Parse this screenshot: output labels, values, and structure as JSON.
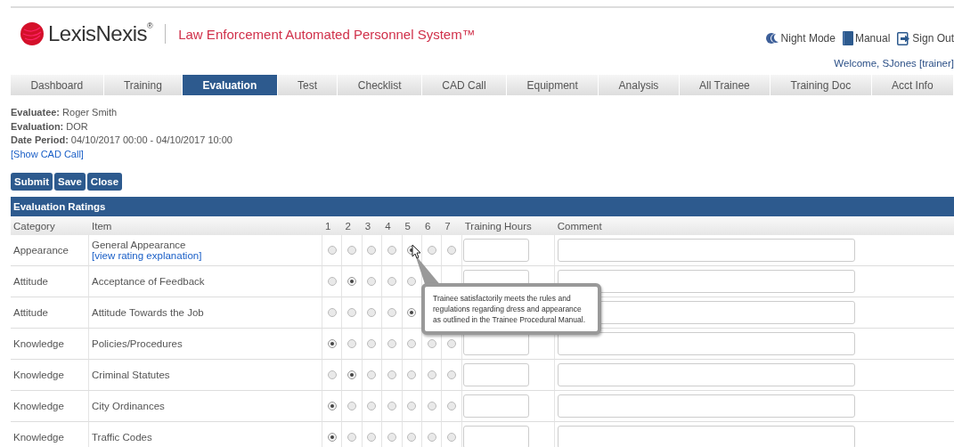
{
  "header": {
    "brand": "LexisNexis",
    "brand_mark": "®",
    "system_title": "Law Enforcement Automated Personnel System™",
    "links": [
      {
        "kind": "night",
        "label": "Night Mode"
      },
      {
        "kind": "manual",
        "label": "Manual"
      },
      {
        "kind": "signout",
        "label": "Sign Out"
      }
    ],
    "welcome": "Welcome, SJones [trainer]"
  },
  "tabs": [
    {
      "label": "Dashboard",
      "selected": false
    },
    {
      "label": "Training",
      "selected": false
    },
    {
      "label": "Evaluation",
      "selected": true
    },
    {
      "label": "Test",
      "selected": false
    },
    {
      "label": "Checklist",
      "selected": false
    },
    {
      "label": "CAD Call",
      "selected": false
    },
    {
      "label": "Equipment",
      "selected": false
    },
    {
      "label": "Analysis",
      "selected": false
    },
    {
      "label": "All Trainee",
      "selected": false
    },
    {
      "label": "Training Doc",
      "selected": false
    },
    {
      "label": "Acct Info",
      "selected": false
    }
  ],
  "info": [
    {
      "label": "Evaluatee:",
      "value": "Roger Smith"
    },
    {
      "label": "Evaluation:",
      "value": "DOR"
    },
    {
      "label": "Date Period:",
      "value": "04/10/2017 00:00 - 04/10/2017 10:00"
    }
  ],
  "show_cad_link": "[Show CAD Call]",
  "buttons": [
    "Submit",
    "Save",
    "Close"
  ],
  "table": {
    "title": "Evaluation Ratings",
    "columns": [
      "Category",
      "Item",
      "1",
      "2",
      "3",
      "4",
      "5",
      "6",
      "7",
      "Training Hours",
      "Comment"
    ],
    "rows": [
      {
        "category": "Appearance",
        "item": "General Appearance",
        "link": "[view rating explanation]",
        "ratings": [
          false,
          false,
          false,
          false,
          true,
          false,
          false
        ],
        "hours_field": true
      },
      {
        "category": "Attitude",
        "item": "Acceptance of Feedback",
        "ratings": [
          false,
          true,
          false,
          false,
          false
        ],
        "hours_field": true
      },
      {
        "category": "Attitude",
        "item": "Attitude Towards the Job",
        "ratings": [
          false,
          false,
          false,
          false,
          true
        ],
        "hours_field": false
      },
      {
        "category": "Knowledge",
        "item": "Policies/Procedures",
        "ratings": [
          true,
          false,
          false,
          false,
          false,
          false,
          false
        ],
        "hours_field": true
      },
      {
        "category": "Knowledge",
        "item": "Criminal Statutes",
        "ratings": [
          false,
          true,
          false,
          false,
          false,
          false,
          false
        ],
        "hours_field": true
      },
      {
        "category": "Knowledge",
        "item": "City Ordinances",
        "ratings": [
          true,
          false,
          false,
          false,
          false,
          false,
          false
        ],
        "hours_field": true
      },
      {
        "category": "Knowledge",
        "item": "Traffic Codes",
        "ratings": [
          true,
          false,
          false,
          false,
          false,
          false,
          false
        ],
        "hours_field": true
      }
    ]
  },
  "tooltip": "Trainee satisfactorily meets the rules and regulations regarding dress and appearance as outlined in the Trainee Procedural Manual."
}
